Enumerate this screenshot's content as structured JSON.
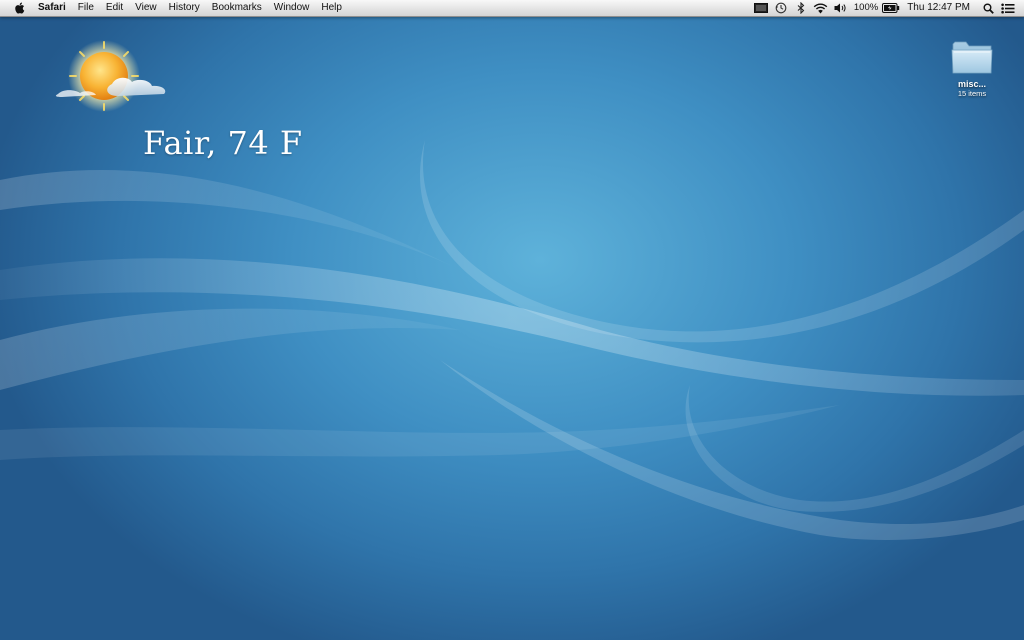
{
  "menubar": {
    "app_name": "Safari",
    "menus": [
      "File",
      "Edit",
      "View",
      "History",
      "Bookmarks",
      "Window",
      "Help"
    ],
    "status": {
      "battery_label": "100%",
      "clock": "Thu 12:47 PM"
    },
    "icons": [
      "apple-icon",
      "display-icon",
      "time-machine-icon",
      "bluetooth-icon",
      "wifi-icon",
      "volume-icon",
      "battery-icon",
      "spotlight-icon",
      "notification-list-icon"
    ]
  },
  "weather_widget": {
    "condition_text": "Fair, 74 F",
    "icon": "sun-with-cloud-icon"
  },
  "desktop_folder": {
    "name": "misc...",
    "info": "15 items",
    "icon": "folder-icon"
  },
  "colors": {
    "desktop_light": "#5eb2da",
    "desktop_dark": "#23598c",
    "menubar_top": "#f8f8f8",
    "menubar_bottom": "#d4d4d4"
  }
}
